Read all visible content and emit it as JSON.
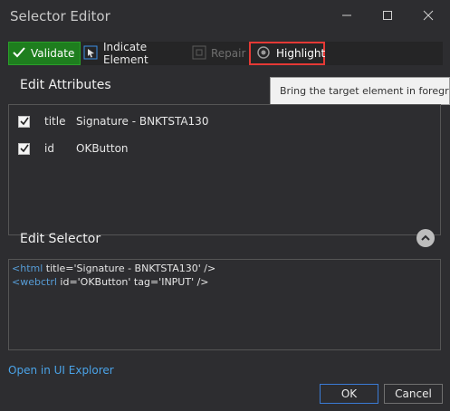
{
  "window": {
    "title": "Selector Editor",
    "minimize_icon": "minimize-icon",
    "maximize_icon": "maximize-icon",
    "close_icon": "close-icon"
  },
  "toolbar": {
    "validate_label": "Validate",
    "indicate_label": "Indicate Element",
    "repair_label": "Repair",
    "highlight_label": "Highlight"
  },
  "tooltip": {
    "text": "Bring the target element in foreground"
  },
  "attributes": {
    "title": "Edit Attributes",
    "rows": [
      {
        "checked": true,
        "name": "title",
        "value": "Signature - BNKTSTA130"
      },
      {
        "checked": true,
        "name": "id",
        "value": "OKButton"
      }
    ]
  },
  "selector": {
    "title": "Edit Selector",
    "line1_tag": "<html",
    "line1_attrs": " title='Signature - BNKTSTA130' />",
    "line2_tag": "<webctrl",
    "line2_attrs": " id='OKButton' tag='INPUT' />"
  },
  "footer": {
    "open_link": "Open in UI Explorer",
    "ok_label": "OK",
    "cancel_label": "Cancel"
  },
  "colors": {
    "background": "#2d2d30",
    "validate_green": "#1e7e1e",
    "highlight_border": "#e53935",
    "tag_blue": "#569cd6",
    "link_blue": "#4aa3e8"
  }
}
